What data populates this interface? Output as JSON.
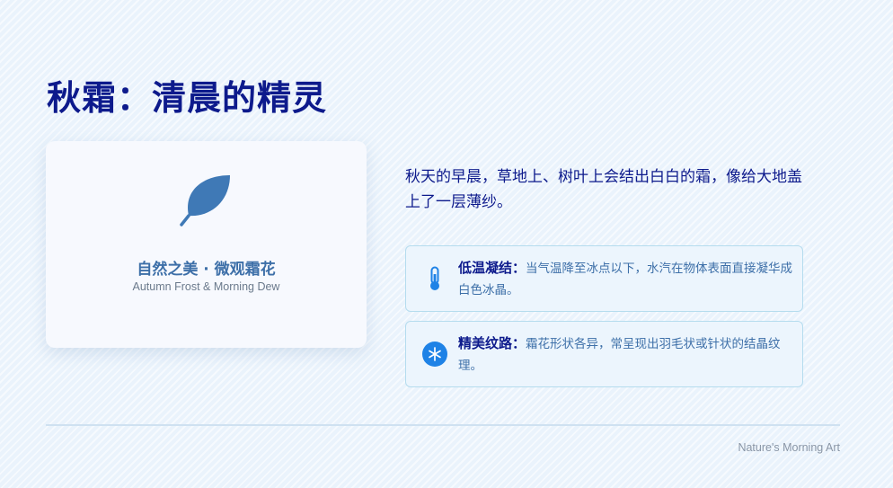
{
  "page": {
    "title": "秋霜：清晨的精灵"
  },
  "image_card": {
    "icon": "leaf-icon",
    "caption": "自然之美 · 微观霜花",
    "subcaption": "Autumn Frost & Morning Dew"
  },
  "intro": "秋天的早晨，草地上、树叶上会结出白白的霜，像给大地盖上了一层薄纱。",
  "facts": [
    {
      "icon": "thermometer-icon",
      "label": "低温凝结：",
      "text": "当气温降至冰点以下，水汽在物体表面直接凝华成白色冰晶。"
    },
    {
      "icon": "snowflake-icon",
      "label": "精美纹路：",
      "text": "霜花形状各异，常呈现出羽毛状或针状的结晶纹理。"
    }
  ],
  "footer": "Nature's Morning Art",
  "colors": {
    "title": "#0d1a8c",
    "accent": "#3d6fa8",
    "icon_blue": "#1e82e6",
    "background": "#eaf3fc"
  }
}
